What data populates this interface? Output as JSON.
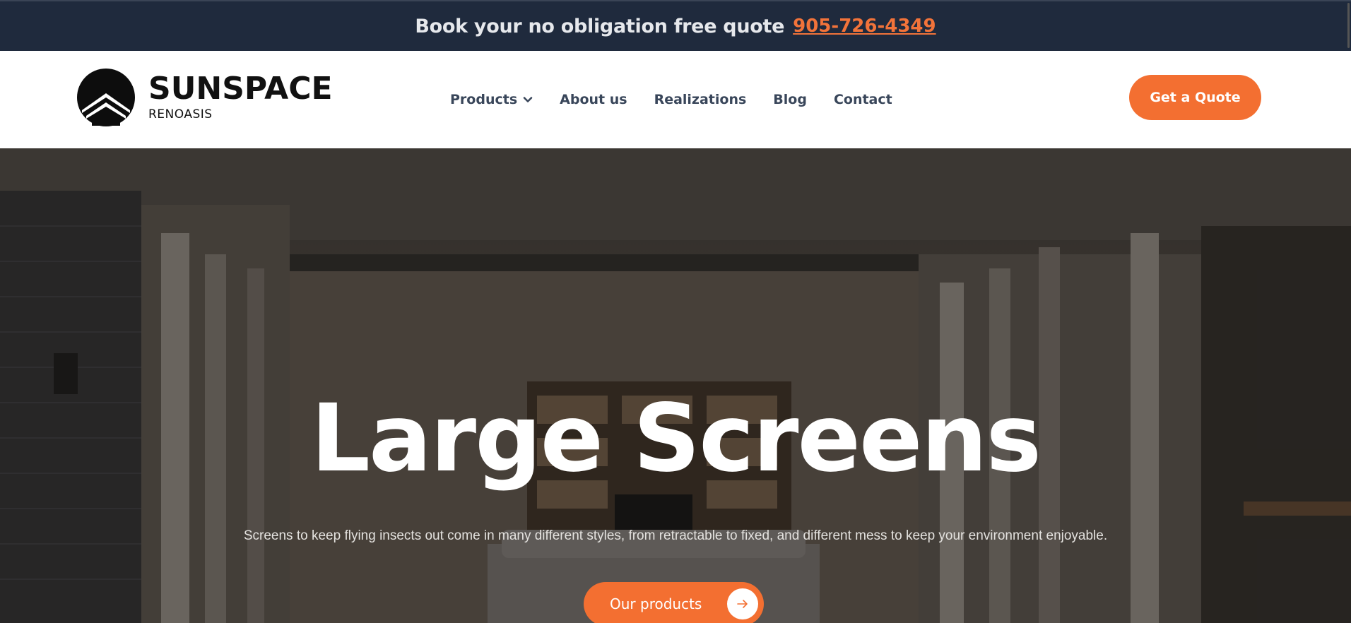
{
  "topbar": {
    "text": "Book your no obligation free quote",
    "phone": "905-726-4349"
  },
  "logo": {
    "name": "SUNSPACE",
    "sub": "RENOASIS",
    "icon": "house-roof-logo-icon"
  },
  "nav": {
    "items": [
      {
        "label": "Products",
        "has_dropdown": true
      },
      {
        "label": "About us"
      },
      {
        "label": "Realizations"
      },
      {
        "label": "Blog"
      },
      {
        "label": "Contact"
      }
    ]
  },
  "header": {
    "cta_label": "Get a Quote"
  },
  "hero": {
    "title": "Large Screens",
    "subtitle": "Screens to keep flying insects out come in many different styles, from retractable to fixed, and different mess to keep your environment enjoyable.",
    "button_label": "Our products",
    "button_icon": "arrow-right-icon"
  },
  "colors": {
    "accent": "#f36f31",
    "topbar_bg": "#1f2a3d",
    "nav_text": "#39465a"
  }
}
